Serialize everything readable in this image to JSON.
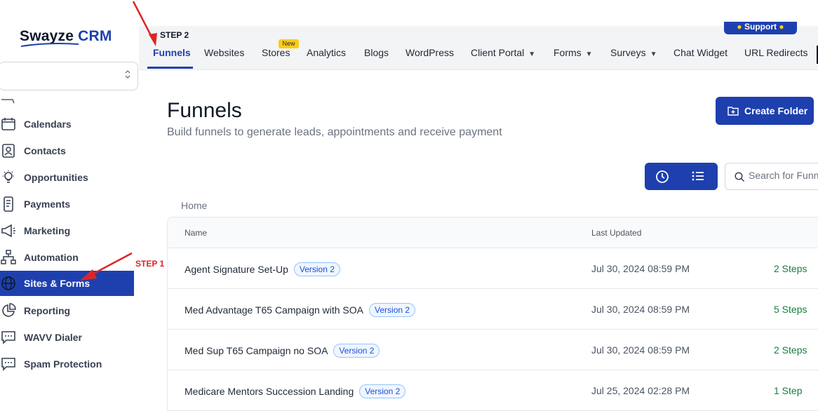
{
  "sidebar": {
    "logo_main": "Swayze",
    "logo_accent": "CRM",
    "items": [
      {
        "label": "Calendars",
        "icon": "calendar-icon"
      },
      {
        "label": "Contacts",
        "icon": "contacts-icon"
      },
      {
        "label": "Opportunities",
        "icon": "lightbulb-icon"
      },
      {
        "label": "Payments",
        "icon": "receipt-icon"
      },
      {
        "label": "Marketing",
        "icon": "megaphone-icon"
      },
      {
        "label": "Automation",
        "icon": "workflow-icon"
      },
      {
        "label": "Sites & Forms",
        "icon": "globe-icon",
        "active": true
      },
      {
        "label": "Reporting",
        "icon": "pie-chart-icon"
      },
      {
        "label": "WAVV Dialer",
        "icon": "chat-icon"
      },
      {
        "label": "Spam Protection",
        "icon": "chat-icon"
      }
    ]
  },
  "topnav": {
    "support_label": "Support",
    "new_badge": "New",
    "tabs": [
      {
        "label": "Funnels",
        "active": true
      },
      {
        "label": "Websites"
      },
      {
        "label": "Stores"
      },
      {
        "label": "Analytics"
      },
      {
        "label": "Blogs"
      },
      {
        "label": "WordPress"
      },
      {
        "label": "Client Portal",
        "dropdown": true
      },
      {
        "label": "Forms",
        "dropdown": true
      },
      {
        "label": "Surveys",
        "dropdown": true
      },
      {
        "label": "Chat Widget"
      },
      {
        "label": "URL Redirects"
      }
    ]
  },
  "page": {
    "title": "Funnels",
    "subtitle": "Build funnels to generate leads, appointments and receive payment",
    "create_button": "Create Folder",
    "search_placeholder": "Search for Funnels",
    "breadcrumb": "Home"
  },
  "table": {
    "columns": {
      "name": "Name",
      "updated": "Last Updated"
    },
    "rows": [
      {
        "name": "Agent Signature Set-Up",
        "version": "Version 2",
        "updated": "Jul 30, 2024 08:59 PM",
        "steps": "2 Steps"
      },
      {
        "name": "Med Advantage T65 Campaign with SOA",
        "version": "Version 2",
        "updated": "Jul 30, 2024 08:59 PM",
        "steps": "5 Steps"
      },
      {
        "name": "Med Sup T65 Campaign no SOA",
        "version": "Version 2",
        "updated": "Jul 30, 2024 08:59 PM",
        "steps": "2 Steps"
      },
      {
        "name": "Medicare Mentors Succession Landing",
        "version": "Version 2",
        "updated": "Jul 25, 2024 02:28 PM",
        "steps": "1 Step"
      }
    ]
  },
  "annotations": {
    "step1": "STEP 1",
    "step2": "STEP 2"
  },
  "colors": {
    "primary": "#1e40af",
    "annotation_red": "#dc2626",
    "steps_green": "#15803d",
    "badge_yellow": "#facc15"
  }
}
